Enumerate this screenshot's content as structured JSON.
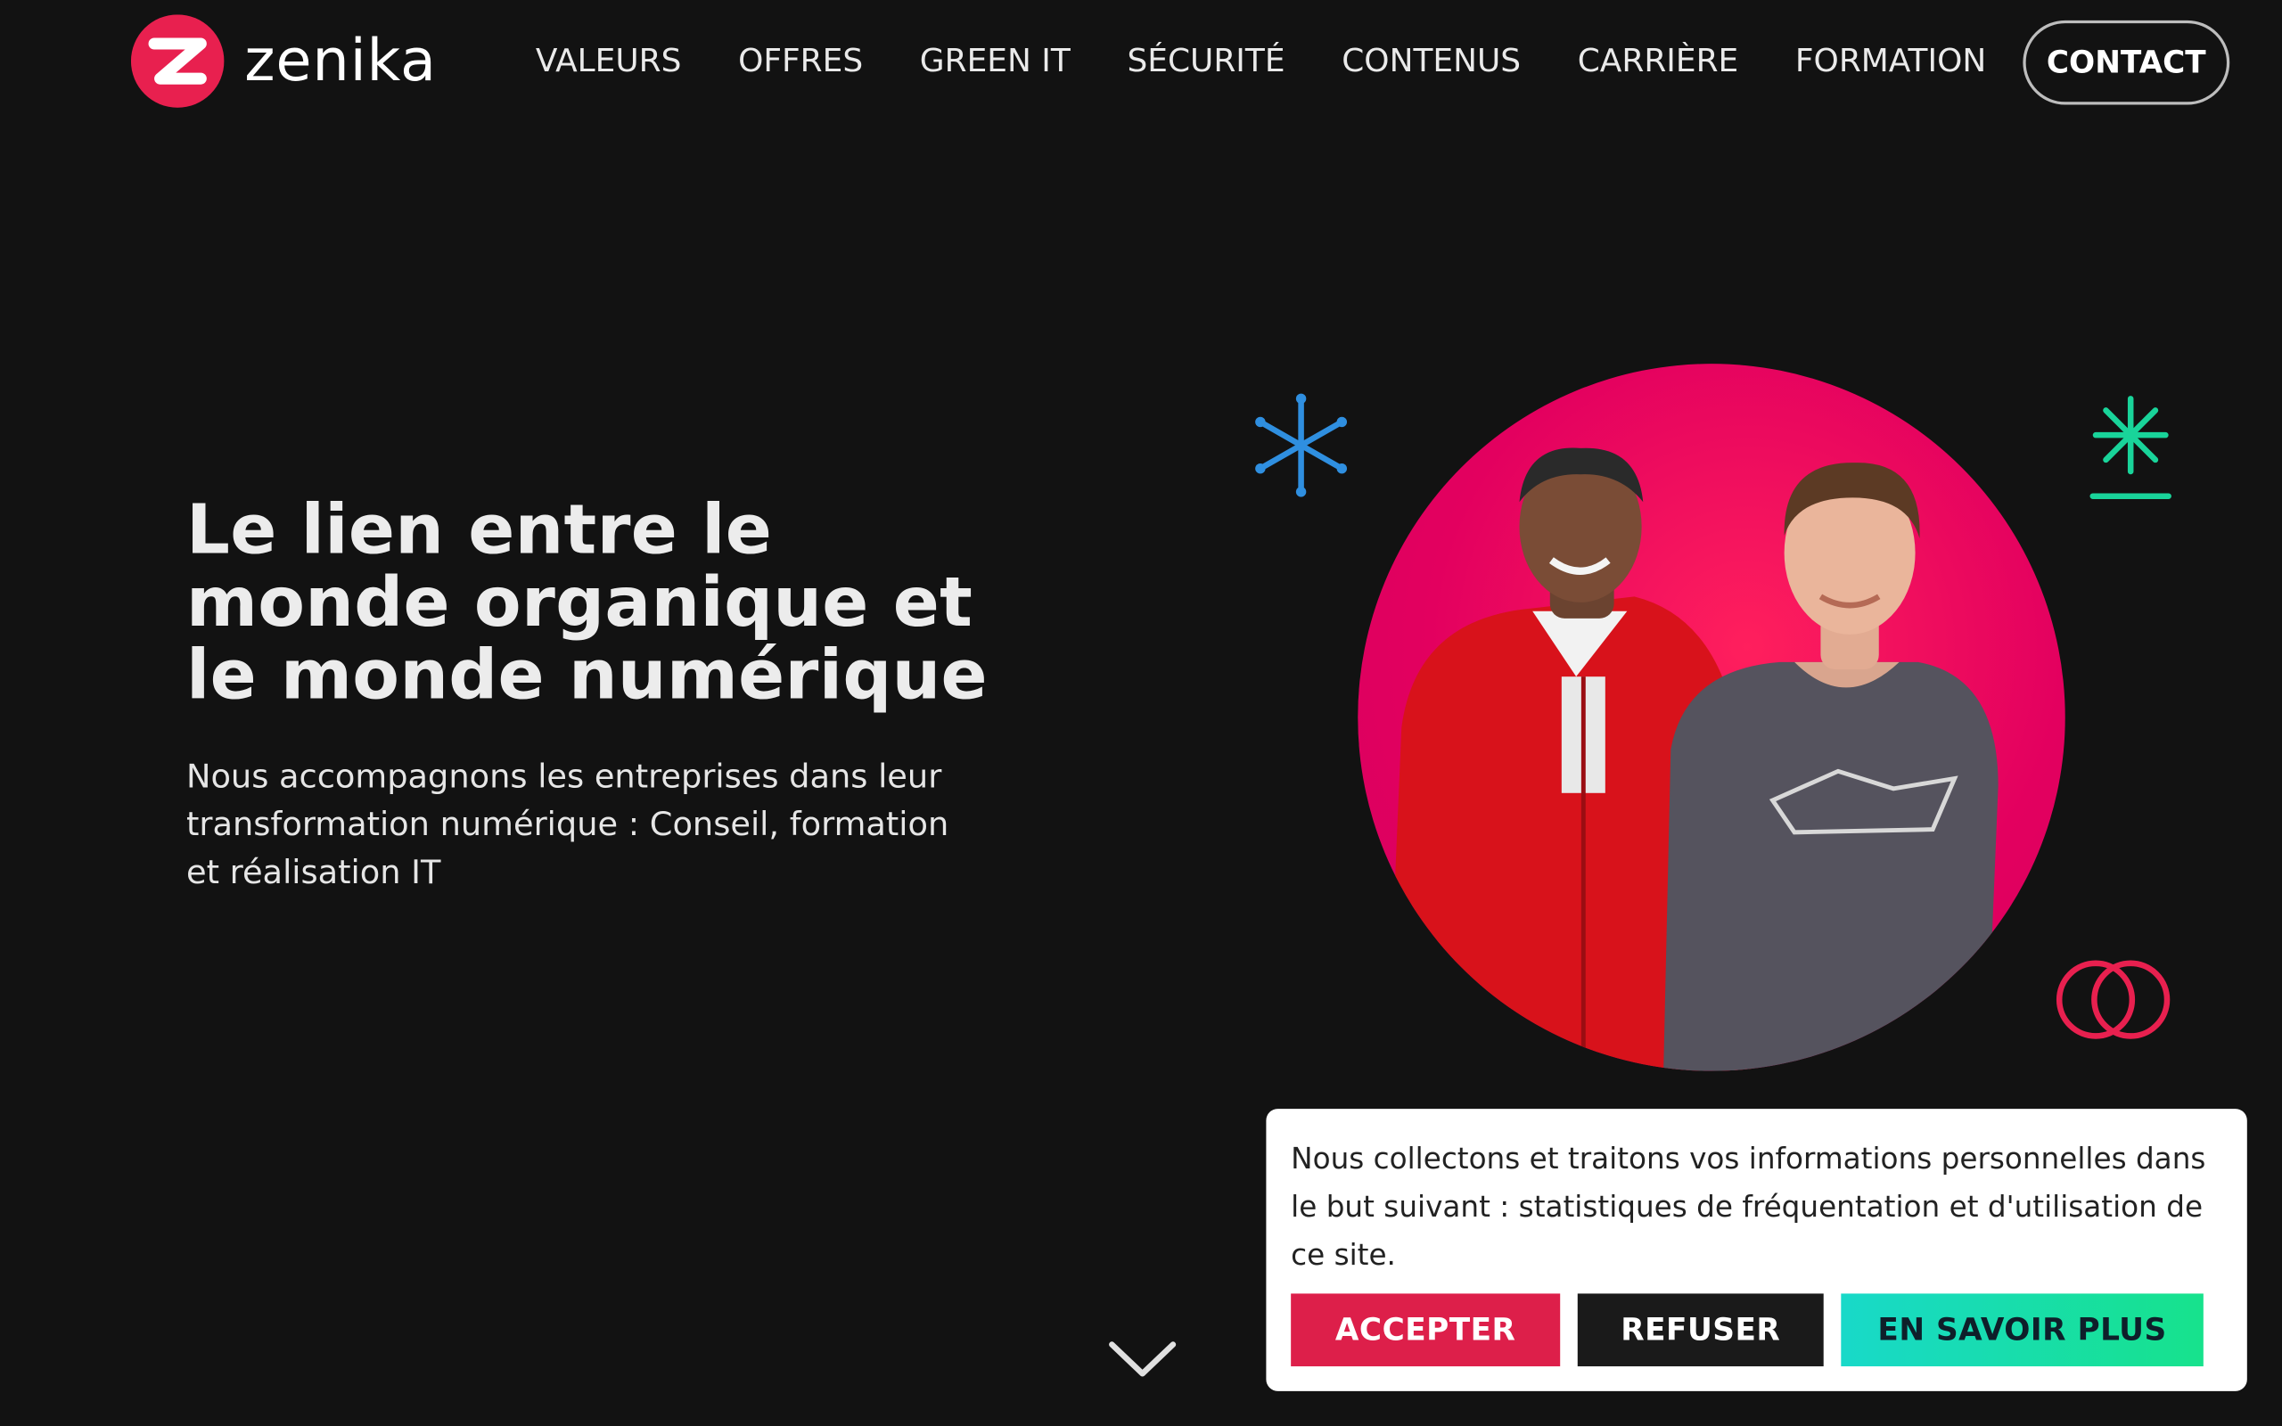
{
  "header": {
    "logo_text": "zenika",
    "nav": [
      {
        "label": "VALEURS"
      },
      {
        "label": "OFFRES"
      },
      {
        "label": "GREEN IT"
      },
      {
        "label": "SÉCURITÉ"
      },
      {
        "label": "CONTENUS"
      },
      {
        "label": "CARRIÈRE"
      },
      {
        "label": "FORMATION"
      }
    ],
    "contact_label": "CONTACT"
  },
  "hero": {
    "title_lines": [
      "Le lien entre le",
      "monde organique et",
      "le monde numérique"
    ],
    "subtitle_lines": [
      "Nous accompagnons les entreprises dans leur",
      "transformation numérique : Conseil, formation",
      "et réalisation IT"
    ]
  },
  "decor": {
    "icons": [
      "snowflake-icon",
      "asterisk-underline-icon",
      "linked-circles-icon",
      "chevron-down-icon"
    ],
    "colors": {
      "blue": "#2f8fe0",
      "green": "#19d49a",
      "pink": "#e8204f",
      "brand": "#e8204f"
    }
  },
  "cookie_banner": {
    "text_lines": [
      "Nous collectons et traitons vos informations personnelles dans",
      "le but suivant : statistiques de fréquentation et d'utilisation de",
      "ce site."
    ],
    "accept_label": "ACCEPTER",
    "refuse_label": "REFUSER",
    "more_label": "EN SAVOIR PLUS"
  }
}
